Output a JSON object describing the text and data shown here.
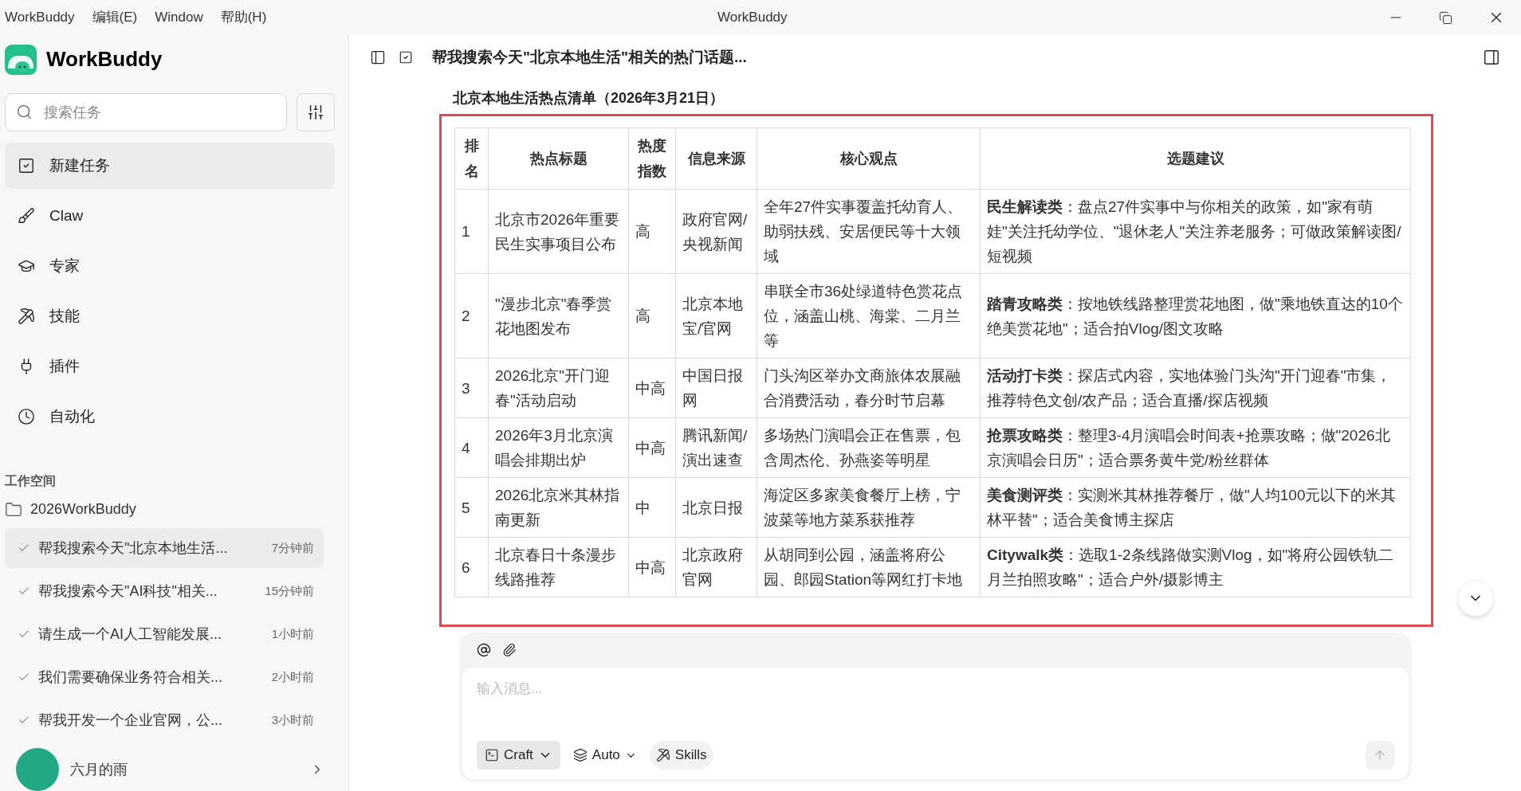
{
  "menu_bar": {
    "items": [
      "WorkBuddy",
      "编辑(E)",
      "Window",
      "帮助(H)"
    ],
    "title": "WorkBuddy"
  },
  "sidebar": {
    "brand": "WorkBuddy",
    "search": {
      "placeholder": "搜索任务"
    },
    "nav": [
      {
        "label": "新建任务",
        "selected": true
      },
      {
        "label": "Claw",
        "selected": false
      },
      {
        "label": "专家",
        "selected": false
      },
      {
        "label": "技能",
        "selected": false
      },
      {
        "label": "插件",
        "selected": false
      },
      {
        "label": "自动化",
        "selected": false
      }
    ],
    "workspace_label": "工作空间",
    "folder": "2026WorkBuddy",
    "tasks": [
      {
        "title": "帮我搜索今天\"北京本地生活...",
        "time": "7分钟前",
        "selected": true
      },
      {
        "title": "帮我搜索今天\"AI科技\"相关...",
        "time": "15分钟前",
        "selected": false
      },
      {
        "title": "请生成一个AI人工智能发展...",
        "time": "1小时前",
        "selected": false
      },
      {
        "title": "我们需要确保业务符合相关...",
        "time": "2小时前",
        "selected": false
      },
      {
        "title": "帮我开发一个企业官网，公...",
        "time": "3小时前",
        "selected": false
      }
    ],
    "user": "六月的雨"
  },
  "conversation": {
    "title": "帮我搜索今天\"北京本地生活\"相关的热门话题...",
    "table_title": "北京本地生活热点清单（2026年3月21日）",
    "table": {
      "columns": [
        "排名",
        "热点标题",
        "热度指数",
        "信息来源",
        "核心观点",
        "选题建议"
      ],
      "rows": [
        [
          "1",
          "北京市2026年重要民生实事项目公布",
          "高",
          "政府官网/央视新闻",
          "全年27件实事覆盖托幼育人、助弱扶残、安居便民等十大领域",
          "**民生解读类**：盘点27件实事中与你相关的政策，如\"家有萌娃\"关注托幼学位、\"退休老人\"关注养老服务；可做政策解读图/短视频"
        ],
        [
          "2",
          "\"漫步北京\"春季赏花地图发布",
          "高",
          "北京本地宝/官网",
          "串联全市36处绿道特色赏花点位，涵盖山桃、海棠、二月兰等",
          "**踏青攻略类**：按地铁线路整理赏花地图，做\"乘地铁直达的10个绝美赏花地\"；适合拍Vlog/图文攻略"
        ],
        [
          "3",
          "2026北京\"开门迎春\"活动启动",
          "中高",
          "中国日报网",
          "门头沟区举办文商旅体农展融合消费活动，春分时节启幕",
          "**活动打卡类**：探店式内容，实地体验门头沟\"开门迎春\"市集，推荐特色文创/农产品；适合直播/探店视频"
        ],
        [
          "4",
          "2026年3月北京演唱会排期出炉",
          "中高",
          "腾讯新闻/演出速查",
          "多场热门演唱会正在售票，包含周杰伦、孙燕姿等明星",
          "**抢票攻略类**：整理3-4月演唱会时间表+抢票攻略；做\"2026北京演唱会日历\"；适合票务黄牛党/粉丝群体"
        ],
        [
          "5",
          "2026北京米其林指南更新",
          "中",
          "北京日报",
          "海淀区多家美食餐厅上榜，宁波菜等地方菜系获推荐",
          "**美食测评类**：实测米其林推荐餐厅，做\"人均100元以下的米其林平替\"；适合美食博主探店"
        ],
        [
          "6",
          "北京春日十条漫步线路推荐",
          "中高",
          "北京政府官网",
          "从胡同到公园，涵盖将府公园、郎园Station等网红打卡地",
          "**Citywalk类**：选取1-2条线路做实测Vlog，如\"将府公园铁轨二月兰拍照攻略\"；适合户外/摄影博主"
        ]
      ]
    }
  },
  "composer": {
    "placeholder": "输入消息...",
    "modes": [
      "Craft",
      "Auto",
      "Skills"
    ]
  }
}
